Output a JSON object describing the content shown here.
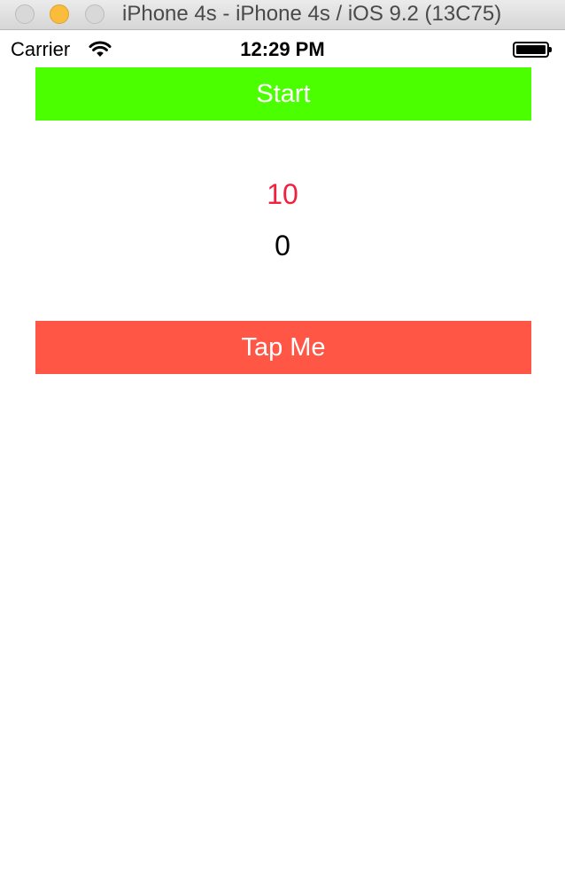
{
  "window": {
    "title": "iPhone 4s - iPhone 4s / iOS 9.2 (13C75)"
  },
  "status_bar": {
    "carrier": "Carrier",
    "time": "12:29 PM",
    "wifi_icon": "wifi-icon",
    "battery_icon": "battery-icon",
    "battery_level": 1.0
  },
  "app": {
    "start_button": {
      "label": "Start",
      "color": "#4cff00"
    },
    "countdown": {
      "value": "10",
      "color": "#f0213e"
    },
    "score": {
      "value": "0"
    },
    "tap_button": {
      "label": "Tap Me",
      "color": "#ff5645"
    }
  }
}
